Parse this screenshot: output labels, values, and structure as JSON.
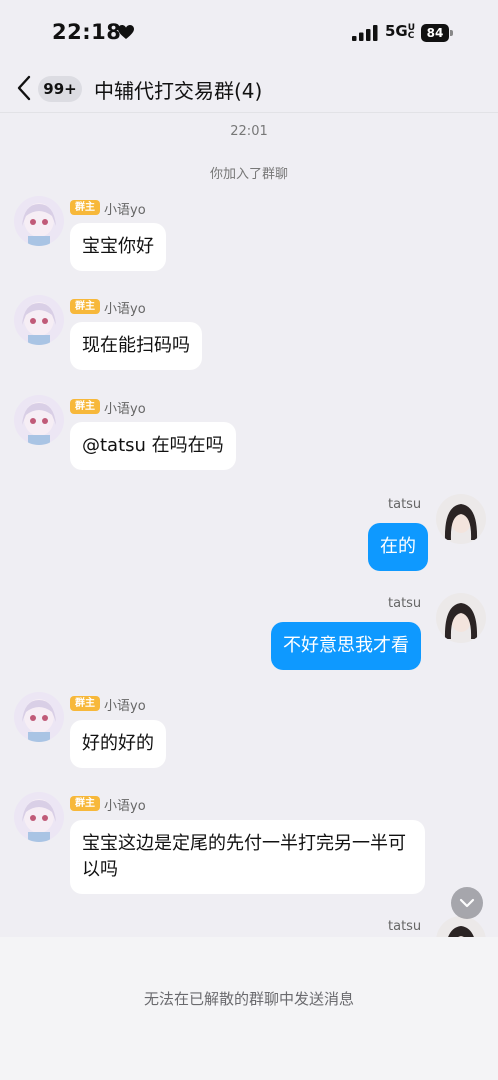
{
  "status_bar": {
    "time": "22:18",
    "network": "5G",
    "network_sub": "UC",
    "battery": "84"
  },
  "header": {
    "unread_badge": "99+",
    "title": "中辅代打交易群(4)"
  },
  "chat": {
    "timestamp": "22:01",
    "system_notice": "你加入了群聊",
    "owner_tag": "群主",
    "messages": [
      {
        "sender": "小语yo",
        "side": "left",
        "text": "宝宝你好"
      },
      {
        "sender": "小语yo",
        "side": "left",
        "text": "现在能扫码吗"
      },
      {
        "sender": "小语yo",
        "side": "left",
        "text": "@tatsu 在吗在吗"
      },
      {
        "sender": "tatsu",
        "side": "right",
        "text": "在的"
      },
      {
        "sender": "tatsu",
        "side": "right",
        "text": "不好意思我才看"
      },
      {
        "sender": "小语yo",
        "side": "left",
        "text": "好的好的"
      },
      {
        "sender": "小语yo",
        "side": "left",
        "text": "宝宝这边是定尾的先付一半打完另一半可以吗"
      },
      {
        "sender": "tatsu",
        "side": "right",
        "text": ""
      }
    ]
  },
  "footer": {
    "notice": "无法在已解散的群聊中发送消息"
  },
  "colors": {
    "accent_blue": "#0e99ff",
    "owner_tag": "#f7b83a",
    "background": "#efeef3"
  },
  "icons": [
    "heart-icon",
    "signal-icon",
    "battery-icon",
    "back-chevron-icon",
    "scroll-down-icon"
  ]
}
